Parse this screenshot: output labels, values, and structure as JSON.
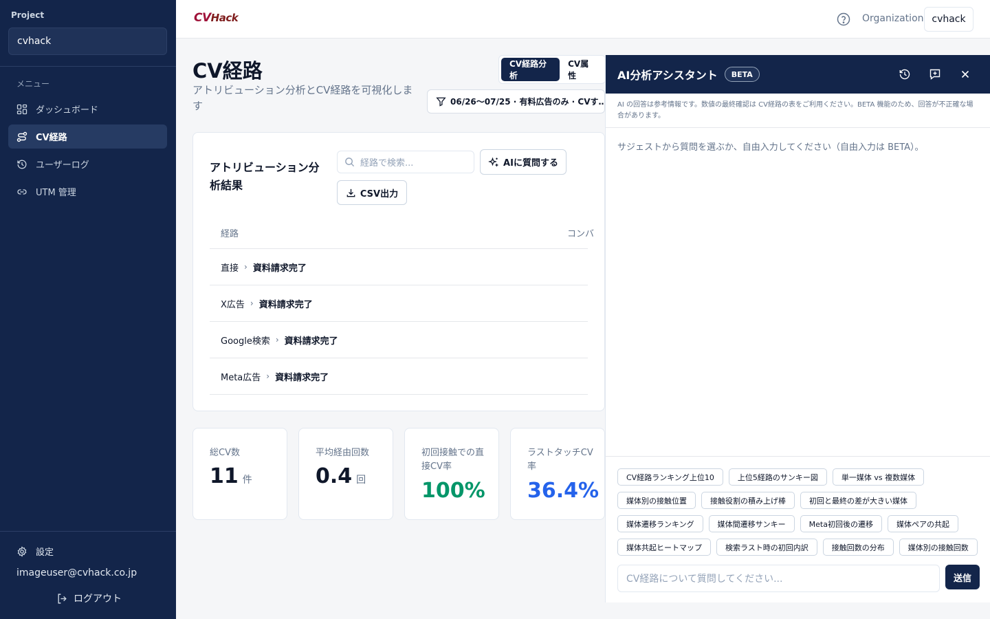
{
  "sidebar": {
    "project_label": "Project",
    "project_value": "cvhack",
    "menu_label": "メニュー",
    "items": [
      {
        "label": "ダッシュボード"
      },
      {
        "label": "CV経路"
      },
      {
        "label": "ユーザーログ"
      },
      {
        "label": "UTM 管理"
      }
    ],
    "settings_label": "設定",
    "email": "imageuser@cvhack.co.jp",
    "logout_label": "ログアウト"
  },
  "header": {
    "logo_cv": "CV",
    "logo_hack": "Hack",
    "org_label": "Organization",
    "org_value": "cvhack"
  },
  "main": {
    "title": "CV経路",
    "subtitle": "アトリビューション分析とCV経路を可視化します",
    "view_tabs": [
      "CV経路分析",
      "CV属性"
    ],
    "filter_label": "06/26〜07/25 · 有料広告のみ · CVす…",
    "card": {
      "title": "アトリビューション分析結果",
      "search_placeholder": "経路で検索...",
      "ai_button": "AIに質問する",
      "csv_button": "CSV出力",
      "columns": [
        "経路",
        "コンバ"
      ],
      "rows": [
        {
          "from": "直接",
          "to": "資料請求完了"
        },
        {
          "from": "X広告",
          "to": "資料請求完了"
        },
        {
          "from": "Google検索",
          "to": "資料請求完了"
        },
        {
          "from": "Meta広告",
          "to": "資料請求完了"
        }
      ]
    },
    "stats": [
      {
        "label": "総CV数",
        "value": "11",
        "unit": "件",
        "color": "#0f172a"
      },
      {
        "label": "平均経由回数",
        "value": "0.4",
        "unit": "回",
        "color": "#0f172a"
      },
      {
        "label": "初回接触での直接CV率",
        "value": "100%",
        "unit": "",
        "color": "#059669"
      },
      {
        "label": "ラストタッチCV率",
        "value": "36.4%",
        "unit": "",
        "color": "#2563eb"
      }
    ]
  },
  "ai_panel": {
    "title": "AI分析アシスタント",
    "badge": "BETA",
    "notice": "AI の回答は参考情報です。数値の最終確認は CV経路の表をご利用ください。BETA 機能のため、回答が不正確な場合があります。",
    "hint": "サジェストから質問を選ぶか、自由入力してください（自由入力は BETA）。",
    "suggestions": [
      "CV経路ランキング上位10",
      "上位5経路のサンキー図",
      "単一媒体 vs 複数媒体",
      "媒体別の接触位置",
      "接触役割の積み上げ棒",
      "初回と最終の差が大きい媒体",
      "媒体遷移ランキング",
      "媒体間遷移サンキー",
      "Meta初回後の遷移",
      "媒体ペアの共起",
      "媒体共起ヒートマップ",
      "検索ラスト時の初回内訳",
      "接触回数の分布",
      "媒体別の接触回数"
    ],
    "input_placeholder": "CV経路について質問してください...",
    "send_label": "送信"
  }
}
